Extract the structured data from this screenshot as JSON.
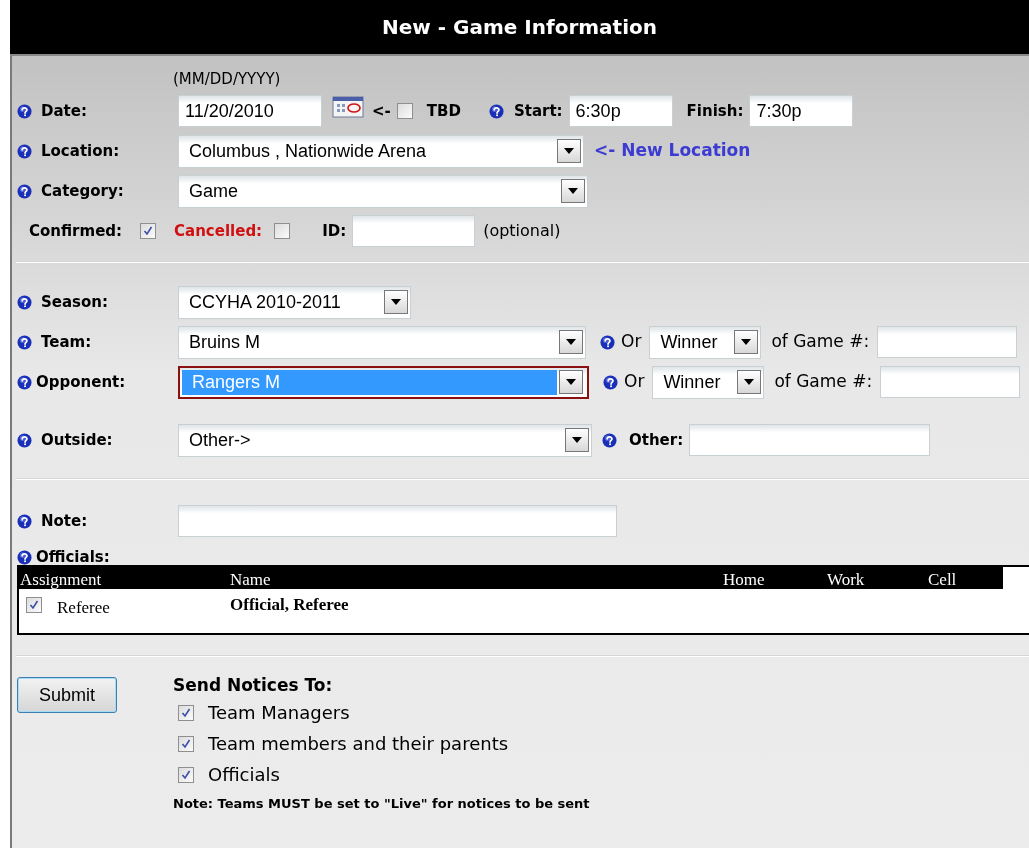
{
  "title": "New - Game Information",
  "date_hint": "(MM/DD/YYYY)",
  "date": {
    "label": "Date:",
    "value": "11/20/2010",
    "arrow": "<-",
    "tbd": {
      "label": "TBD",
      "checked": false
    }
  },
  "start": {
    "label": "Start:",
    "value": "6:30p"
  },
  "finish": {
    "label": "Finish:",
    "value": "7:30p"
  },
  "location": {
    "label": "Location:",
    "value": "Columbus , Nationwide Arena",
    "link": "<- New Location"
  },
  "category": {
    "label": "Category:",
    "value": "Game"
  },
  "confirmed": {
    "label": "Confirmed:",
    "checked": true
  },
  "cancelled": {
    "label": "Cancelled:",
    "checked": false
  },
  "id": {
    "label": "ID:",
    "hint": "(optional)"
  },
  "season": {
    "label": "Season:",
    "value": "CCYHA 2010-2011"
  },
  "matchups": [
    {
      "label": "Team:",
      "value": "Bruins M",
      "focused": false,
      "or_label": "Or",
      "mode": "Winner",
      "game_label": "of Game #:"
    },
    {
      "label": "Opponent:",
      "value": "Rangers M",
      "focused": true,
      "or_label": "Or",
      "mode": "Winner",
      "game_label": "of Game #:"
    }
  ],
  "outside": {
    "label": "Outside:",
    "value": "Other->",
    "other_label": "Other:"
  },
  "note": {
    "label": "Note:"
  },
  "officials": {
    "label": "Officials:",
    "columns": [
      "Assignment",
      "Name",
      "Home",
      "Work",
      "Cell"
    ],
    "rows": [
      {
        "checked": true,
        "assignment": "Referee",
        "name": "Official, Referee"
      }
    ]
  },
  "submit": "Submit",
  "notices": {
    "heading": "Send Notices To:",
    "items": [
      {
        "label": "Team Managers",
        "checked": true
      },
      {
        "label": "Team members and their parents",
        "checked": true
      },
      {
        "label": "Officials",
        "checked": true
      }
    ],
    "warning": "Note: Teams MUST be set to \"Live\" for notices to be sent"
  }
}
